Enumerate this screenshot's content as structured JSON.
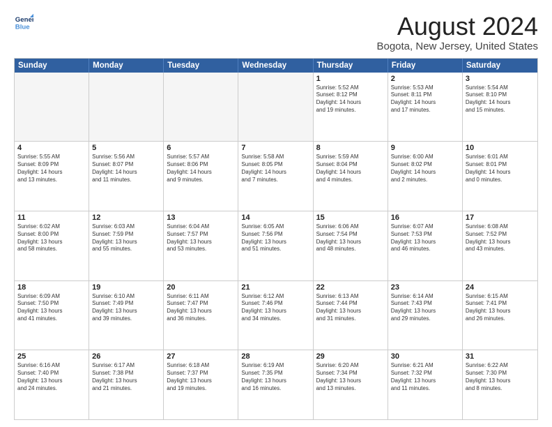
{
  "logo": {
    "line1": "General",
    "line2": "Blue"
  },
  "title": "August 2024",
  "location": "Bogota, New Jersey, United States",
  "days_of_week": [
    "Sunday",
    "Monday",
    "Tuesday",
    "Wednesday",
    "Thursday",
    "Friday",
    "Saturday"
  ],
  "weeks": [
    [
      {
        "day": "",
        "text": "",
        "empty": true
      },
      {
        "day": "",
        "text": "",
        "empty": true
      },
      {
        "day": "",
        "text": "",
        "empty": true
      },
      {
        "day": "",
        "text": "",
        "empty": true
      },
      {
        "day": "1",
        "text": "Sunrise: 5:52 AM\nSunset: 8:12 PM\nDaylight: 14 hours\nand 19 minutes.",
        "empty": false
      },
      {
        "day": "2",
        "text": "Sunrise: 5:53 AM\nSunset: 8:11 PM\nDaylight: 14 hours\nand 17 minutes.",
        "empty": false
      },
      {
        "day": "3",
        "text": "Sunrise: 5:54 AM\nSunset: 8:10 PM\nDaylight: 14 hours\nand 15 minutes.",
        "empty": false
      }
    ],
    [
      {
        "day": "4",
        "text": "Sunrise: 5:55 AM\nSunset: 8:09 PM\nDaylight: 14 hours\nand 13 minutes.",
        "empty": false
      },
      {
        "day": "5",
        "text": "Sunrise: 5:56 AM\nSunset: 8:07 PM\nDaylight: 14 hours\nand 11 minutes.",
        "empty": false
      },
      {
        "day": "6",
        "text": "Sunrise: 5:57 AM\nSunset: 8:06 PM\nDaylight: 14 hours\nand 9 minutes.",
        "empty": false
      },
      {
        "day": "7",
        "text": "Sunrise: 5:58 AM\nSunset: 8:05 PM\nDaylight: 14 hours\nand 7 minutes.",
        "empty": false
      },
      {
        "day": "8",
        "text": "Sunrise: 5:59 AM\nSunset: 8:04 PM\nDaylight: 14 hours\nand 4 minutes.",
        "empty": false
      },
      {
        "day": "9",
        "text": "Sunrise: 6:00 AM\nSunset: 8:02 PM\nDaylight: 14 hours\nand 2 minutes.",
        "empty": false
      },
      {
        "day": "10",
        "text": "Sunrise: 6:01 AM\nSunset: 8:01 PM\nDaylight: 14 hours\nand 0 minutes.",
        "empty": false
      }
    ],
    [
      {
        "day": "11",
        "text": "Sunrise: 6:02 AM\nSunset: 8:00 PM\nDaylight: 13 hours\nand 58 minutes.",
        "empty": false
      },
      {
        "day": "12",
        "text": "Sunrise: 6:03 AM\nSunset: 7:59 PM\nDaylight: 13 hours\nand 55 minutes.",
        "empty": false
      },
      {
        "day": "13",
        "text": "Sunrise: 6:04 AM\nSunset: 7:57 PM\nDaylight: 13 hours\nand 53 minutes.",
        "empty": false
      },
      {
        "day": "14",
        "text": "Sunrise: 6:05 AM\nSunset: 7:56 PM\nDaylight: 13 hours\nand 51 minutes.",
        "empty": false
      },
      {
        "day": "15",
        "text": "Sunrise: 6:06 AM\nSunset: 7:54 PM\nDaylight: 13 hours\nand 48 minutes.",
        "empty": false
      },
      {
        "day": "16",
        "text": "Sunrise: 6:07 AM\nSunset: 7:53 PM\nDaylight: 13 hours\nand 46 minutes.",
        "empty": false
      },
      {
        "day": "17",
        "text": "Sunrise: 6:08 AM\nSunset: 7:52 PM\nDaylight: 13 hours\nand 43 minutes.",
        "empty": false
      }
    ],
    [
      {
        "day": "18",
        "text": "Sunrise: 6:09 AM\nSunset: 7:50 PM\nDaylight: 13 hours\nand 41 minutes.",
        "empty": false
      },
      {
        "day": "19",
        "text": "Sunrise: 6:10 AM\nSunset: 7:49 PM\nDaylight: 13 hours\nand 39 minutes.",
        "empty": false
      },
      {
        "day": "20",
        "text": "Sunrise: 6:11 AM\nSunset: 7:47 PM\nDaylight: 13 hours\nand 36 minutes.",
        "empty": false
      },
      {
        "day": "21",
        "text": "Sunrise: 6:12 AM\nSunset: 7:46 PM\nDaylight: 13 hours\nand 34 minutes.",
        "empty": false
      },
      {
        "day": "22",
        "text": "Sunrise: 6:13 AM\nSunset: 7:44 PM\nDaylight: 13 hours\nand 31 minutes.",
        "empty": false
      },
      {
        "day": "23",
        "text": "Sunrise: 6:14 AM\nSunset: 7:43 PM\nDaylight: 13 hours\nand 29 minutes.",
        "empty": false
      },
      {
        "day": "24",
        "text": "Sunrise: 6:15 AM\nSunset: 7:41 PM\nDaylight: 13 hours\nand 26 minutes.",
        "empty": false
      }
    ],
    [
      {
        "day": "25",
        "text": "Sunrise: 6:16 AM\nSunset: 7:40 PM\nDaylight: 13 hours\nand 24 minutes.",
        "empty": false
      },
      {
        "day": "26",
        "text": "Sunrise: 6:17 AM\nSunset: 7:38 PM\nDaylight: 13 hours\nand 21 minutes.",
        "empty": false
      },
      {
        "day": "27",
        "text": "Sunrise: 6:18 AM\nSunset: 7:37 PM\nDaylight: 13 hours\nand 19 minutes.",
        "empty": false
      },
      {
        "day": "28",
        "text": "Sunrise: 6:19 AM\nSunset: 7:35 PM\nDaylight: 13 hours\nand 16 minutes.",
        "empty": false
      },
      {
        "day": "29",
        "text": "Sunrise: 6:20 AM\nSunset: 7:34 PM\nDaylight: 13 hours\nand 13 minutes.",
        "empty": false
      },
      {
        "day": "30",
        "text": "Sunrise: 6:21 AM\nSunset: 7:32 PM\nDaylight: 13 hours\nand 11 minutes.",
        "empty": false
      },
      {
        "day": "31",
        "text": "Sunrise: 6:22 AM\nSunset: 7:30 PM\nDaylight: 13 hours\nand 8 minutes.",
        "empty": false
      }
    ]
  ]
}
